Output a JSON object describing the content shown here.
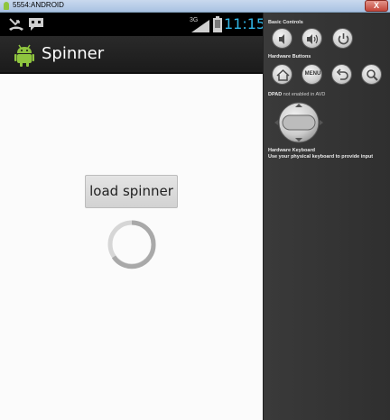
{
  "window": {
    "title": "5554:ANDROID",
    "close_label": "X"
  },
  "status_bar": {
    "network": "3G",
    "time": "11:15",
    "time_color": "#31b6e7"
  },
  "action_bar": {
    "title": "Spinner"
  },
  "content": {
    "button_label": "load spinner"
  },
  "panel": {
    "basic_controls_label": "Basic Controls",
    "hardware_buttons_label": "Hardware Buttons",
    "menu_label": "MENU",
    "dpad_label": "DPAD",
    "dpad_note": "not enabled in AVD",
    "keyboard_label": "Hardware Keyboard",
    "keyboard_hint": "Use your physical keyboard to provide input"
  },
  "icons": {
    "window": "android-logo-icon",
    "status": [
      "missed-call-icon",
      "chat-icon",
      "signal-icon",
      "battery-icon"
    ],
    "basic_controls": [
      "volume-down-icon",
      "volume-up-icon",
      "power-icon"
    ],
    "hardware_buttons": [
      "home-icon",
      "menu-icon",
      "back-icon",
      "search-icon"
    ]
  }
}
